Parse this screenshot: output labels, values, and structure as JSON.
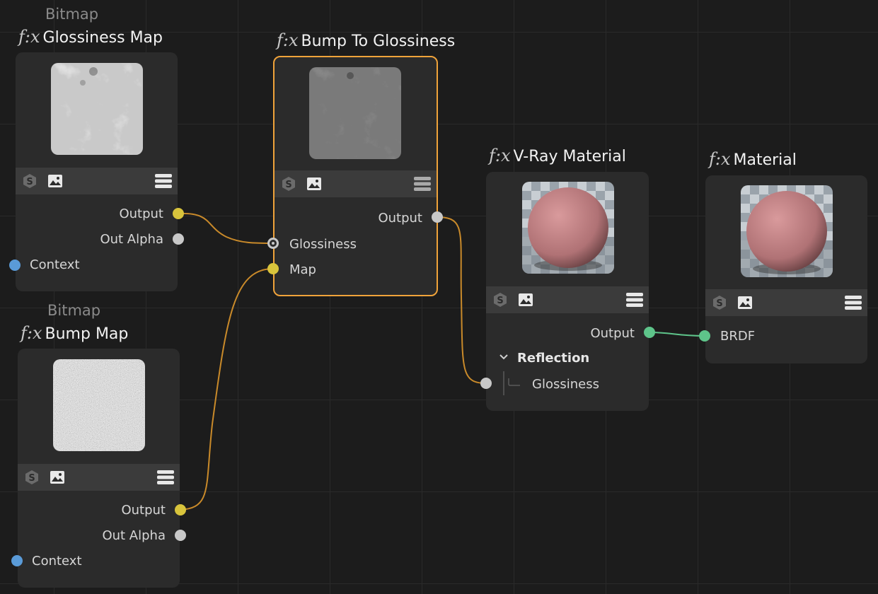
{
  "colors": {
    "background": "#1c1c1c",
    "node": "#2b2b2b",
    "toolbar": "#3b3b3b",
    "selection": "#f0a33a",
    "wire_float": "#c98a2a",
    "wire_brdf": "#5ec48a",
    "port_color": "#d8c43c",
    "port_float": "#c8c8c8",
    "port_context": "#5a9bd8",
    "port_brdf": "#5ec48a"
  },
  "toolbar_icons": [
    "shader-s-icon",
    "image-icon",
    "menu-icon"
  ],
  "nodes": {
    "glossiness_map": {
      "subtitle": "Bitmap",
      "fx": "f:x",
      "title": "Glossiness Map",
      "outputs": [
        "Output",
        "Out Alpha"
      ],
      "inputs": [
        "Context"
      ]
    },
    "bump_map": {
      "subtitle": "Bitmap",
      "fx": "f:x",
      "title": "Bump Map",
      "outputs": [
        "Output",
        "Out Alpha"
      ],
      "inputs": [
        "Context"
      ]
    },
    "bump_to_glossiness": {
      "fx": "f:x",
      "title": "Bump To Glossiness",
      "outputs": [
        "Output"
      ],
      "inputs": [
        "Glossiness",
        "Map"
      ]
    },
    "vray_material": {
      "fx": "f:x",
      "title": "V-Ray Material",
      "outputs": [
        "Output"
      ],
      "section": "Reflection",
      "inputs": [
        "Glossiness"
      ]
    },
    "material": {
      "fx": "f:x",
      "title": "Material",
      "inputs": [
        "BRDF"
      ]
    }
  }
}
